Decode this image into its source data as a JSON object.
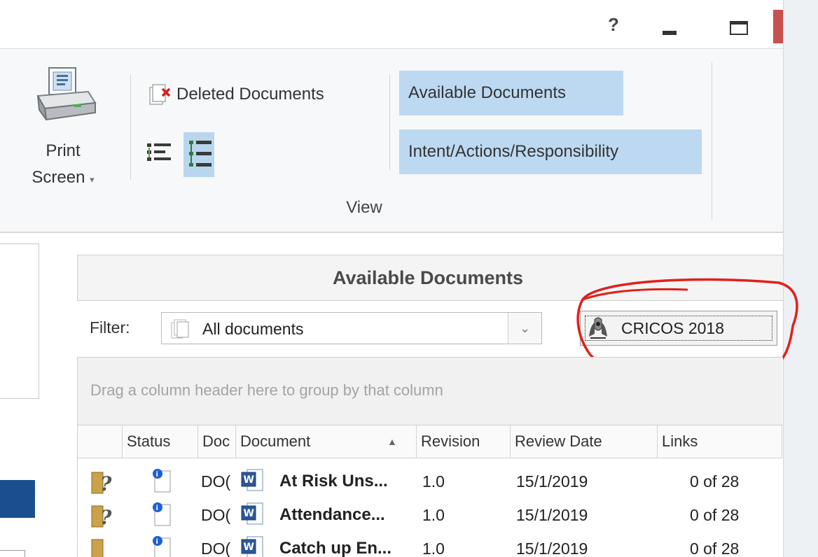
{
  "titlebar": {
    "help_glyph": "?"
  },
  "ribbon": {
    "print": {
      "label_line1": "Print",
      "label_line2": "Screen",
      "dropdown_glyph": "▾"
    },
    "deleted_documents": "Deleted Documents",
    "available_documents": "Available Documents",
    "intent_actions": "Intent/Actions/Responsibility",
    "group_label": "View"
  },
  "panel": {
    "title": "Available Documents"
  },
  "filter": {
    "label": "Filter:",
    "value": "All documents",
    "dropdown_glyph": "⌄"
  },
  "cricos_button": {
    "label": "CRICOS 2018"
  },
  "grid": {
    "group_hint": "Drag a column header here to group by that column",
    "columns": [
      "",
      "Status",
      "Doc",
      "Document",
      "Revision",
      "Review Date",
      "Links"
    ],
    "sort_glyph": "▲",
    "rows": [
      {
        "doc_id": "DO(",
        "document": "At Risk Uns...",
        "revision": "1.0",
        "review_date": "15/1/2019",
        "links": "0 of 28"
      },
      {
        "doc_id": "DO(",
        "document": "Attendance...",
        "revision": "1.0",
        "review_date": "15/1/2019",
        "links": "0 of 28"
      },
      {
        "doc_id": "DO(",
        "document": "Catch up En...",
        "revision": "1.0",
        "review_date": "15/1/2019",
        "links": "0 of 28"
      }
    ]
  },
  "colors": {
    "selected_blue": "#bcd9f1",
    "annotation_red": "#e0201b",
    "status_blue": "#1f5fd6"
  }
}
